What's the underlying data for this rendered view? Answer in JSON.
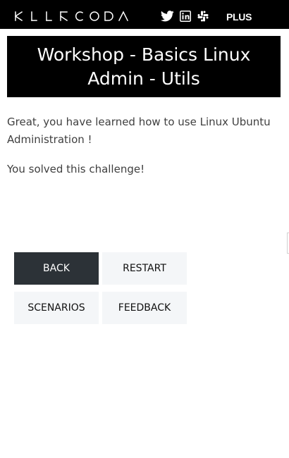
{
  "header": {
    "logo_text": "KILLERCODA",
    "plus_label": "PLUS",
    "icons": [
      "twitter-icon",
      "linkedin-icon",
      "slack-icon"
    ]
  },
  "main": {
    "title": "Workshop - Basics Linux Admin - Utils",
    "message": "Great, you have learned how to use Linux Ubuntu Administration !",
    "solved": "You solved this challenge!"
  },
  "buttons": {
    "back": "BACK",
    "restart": "RESTART",
    "scenarios": "SCENARIOS",
    "feedback": "FEEDBACK"
  },
  "colors": {
    "header_bg": "#000000",
    "title_bg": "#000000",
    "primary_button": "#2c3237",
    "secondary_button": "#f4f6f8",
    "body_text": "#3f3f3f"
  }
}
